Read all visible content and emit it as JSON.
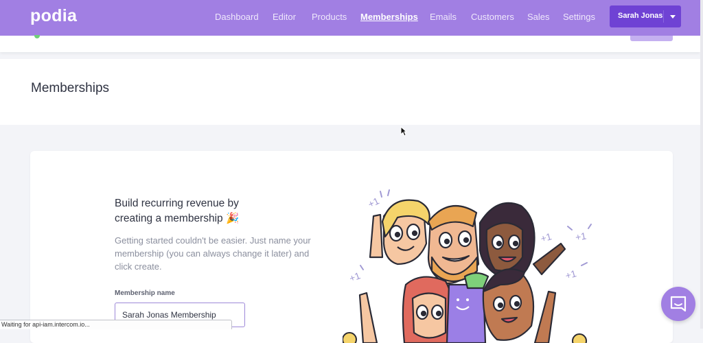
{
  "brand": {
    "logo_text": "podia",
    "accent": "#a17fe3",
    "button_color": "#6f42d4"
  },
  "nav": {
    "items": [
      {
        "label": "Dashboard",
        "active": false
      },
      {
        "label": "Editor",
        "active": false
      },
      {
        "label": "Products",
        "active": false
      },
      {
        "label": "Memberships",
        "active": true
      },
      {
        "label": "Emails",
        "active": false
      },
      {
        "label": "Customers",
        "active": false
      },
      {
        "label": "Sales",
        "active": false
      },
      {
        "label": "Settings",
        "active": false
      }
    ],
    "user_name": "Sarah Jonas"
  },
  "page": {
    "title": "Memberships"
  },
  "card": {
    "heading": "Build recurring revenue by creating a membership 🎉",
    "description": "Getting started couldn't be easier. Just name your membership (you can always change it later) and click create.",
    "field_label": "Membership name",
    "field_value": "Sarah Jonas Membership",
    "illustration_marks": [
      "+1",
      "+1",
      "+1",
      "+1",
      "+1"
    ]
  },
  "status_bar": {
    "text": "Waiting for api-iam.intercom.io..."
  },
  "icons": {
    "chat": "chat-bubble-icon",
    "caret": "chevron-down-icon",
    "pointer": "mouse-cursor-icon"
  }
}
